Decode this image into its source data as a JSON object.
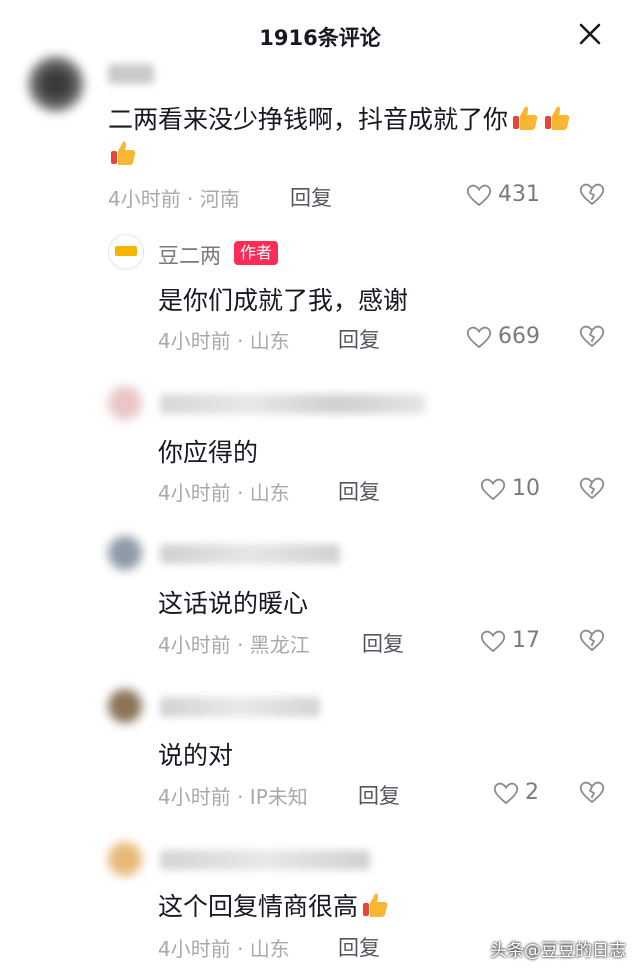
{
  "header": {
    "title": "1916条评论"
  },
  "comments": [
    {
      "text": "二两看来没少挣钱啊，抖音成就了你",
      "time": "4小时前 · 河南",
      "reply": "回复",
      "likes": "431"
    },
    {
      "name": "豆二两",
      "badge": "作者",
      "text": "是你们成就了我，感谢",
      "time": "4小时前 · 山东",
      "reply": "回复",
      "likes": "669"
    },
    {
      "text": "你应得的",
      "time": "4小时前 · 山东",
      "reply": "回复",
      "likes": "10"
    },
    {
      "text": "这话说的暖心",
      "time": "4小时前 · 黑龙江",
      "reply": "回复",
      "likes": "17"
    },
    {
      "text": "说的对",
      "time": "4小时前 · IP未知",
      "reply": "回复",
      "likes": "2"
    },
    {
      "text": "这个回复情商很高",
      "time": "4小时前 · 山东",
      "reply": "回复"
    }
  ],
  "watermark": "头条@豆豆的日志",
  "colors": {
    "accent": "#fe2c55",
    "text": "#161823",
    "meta": "#a7a9ad"
  }
}
